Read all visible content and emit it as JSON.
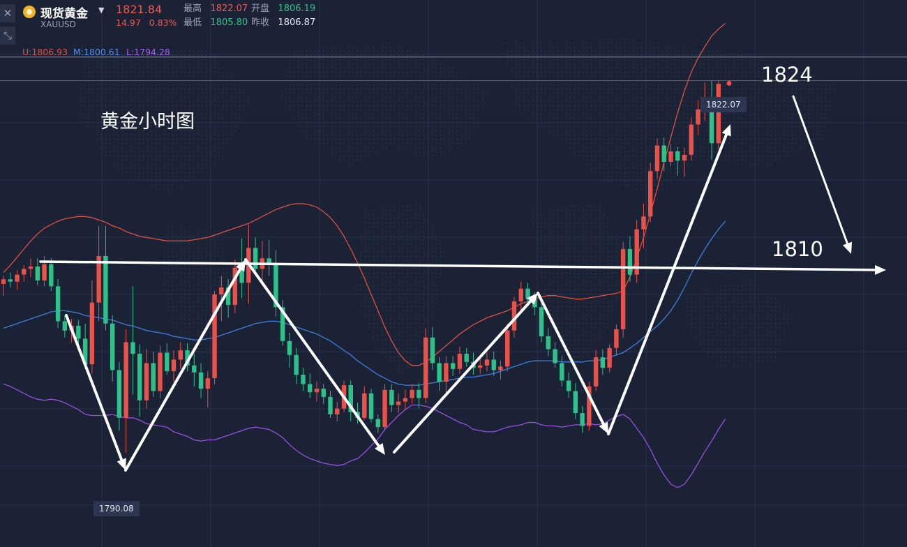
{
  "header": {
    "name": "现货黄金",
    "symbol": "XAUUSD",
    "last_price": "1821.84",
    "change": "14.97",
    "change_pct": "0.83%",
    "high_label": "最高",
    "high_value": "1822.07",
    "open_label": "开盘",
    "open_value": "1806.19",
    "low_label": "最低",
    "low_value": "1805.80",
    "prev_close_label": "昨收",
    "prev_close_value": "1806.87"
  },
  "bollinger": {
    "upper_label": "U:1806.93",
    "mid_label": "M:1800.61",
    "lower_label": "L:1794.28",
    "upper_color": "#e2503f",
    "mid_color": "#3f7fe0",
    "lower_color": "#9b4fe0"
  },
  "annotations": {
    "title_note": "黄金小时图",
    "target_high": "1824",
    "target_support": "1810",
    "high_tag": "1822.07",
    "low_tag": "1790.08"
  },
  "colors": {
    "background": "#1b2235",
    "up": "#e9524a",
    "down": "#2ec28b",
    "grid": "#2a3350"
  },
  "chart_data": {
    "type": "candlestick",
    "title": "黄金小时图",
    "ylim": [
      1782,
      1829
    ],
    "grid": true,
    "series": [
      {
        "name": "candles",
        "values": [
          [
            1804.6,
            1805.3,
            1803.6,
            1805.0
          ],
          [
            1805.0,
            1805.6,
            1804.3,
            1804.8
          ],
          [
            1804.8,
            1805.8,
            1804.1,
            1805.4
          ],
          [
            1805.4,
            1806.2,
            1804.8,
            1805.9
          ],
          [
            1805.9,
            1806.8,
            1805.2,
            1806.1
          ],
          [
            1806.1,
            1806.8,
            1804.5,
            1804.9
          ],
          [
            1804.9,
            1807.0,
            1804.4,
            1806.3
          ],
          [
            1806.3,
            1806.8,
            1804.0,
            1804.4
          ],
          [
            1804.4,
            1805.0,
            1800.8,
            1801.4
          ],
          [
            1801.4,
            1801.9,
            1800.0,
            1800.6
          ],
          [
            1800.6,
            1801.6,
            1799.6,
            1801.0
          ],
          [
            1801.0,
            1801.5,
            1799.2,
            1799.9
          ],
          [
            1799.9,
            1801.2,
            1797.3,
            1797.7
          ],
          [
            1797.7,
            1804.9,
            1796.9,
            1803.0
          ],
          [
            1803.0,
            1809.6,
            1801.4,
            1807.0
          ],
          [
            1807.0,
            1809.6,
            1800.6,
            1801.2
          ],
          [
            1801.2,
            1801.9,
            1796.2,
            1797.2
          ],
          [
            1797.2,
            1797.9,
            1792.0,
            1793.1
          ],
          [
            1793.1,
            1800.7,
            1790.1,
            1799.6
          ],
          [
            1799.6,
            1804.4,
            1795.1,
            1798.6
          ],
          [
            1798.6,
            1799.4,
            1793.2,
            1794.6
          ],
          [
            1794.6,
            1799.0,
            1793.9,
            1797.8
          ],
          [
            1797.8,
            1798.8,
            1794.9,
            1795.4
          ],
          [
            1795.4,
            1799.3,
            1794.8,
            1798.7
          ],
          [
            1798.7,
            1799.5,
            1796.8,
            1797.1
          ],
          [
            1797.1,
            1798.9,
            1796.2,
            1798.1
          ],
          [
            1798.1,
            1799.6,
            1797.3,
            1798.9
          ],
          [
            1798.9,
            1799.5,
            1797.1,
            1797.6
          ],
          [
            1797.6,
            1798.6,
            1795.8,
            1797.0
          ],
          [
            1797.0,
            1797.8,
            1794.8,
            1795.6
          ],
          [
            1795.6,
            1797.1,
            1794.0,
            1796.5
          ],
          [
            1796.5,
            1804.0,
            1796.0,
            1803.7
          ],
          [
            1803.7,
            1805.3,
            1801.4,
            1804.3
          ],
          [
            1804.3,
            1805.0,
            1801.7,
            1802.8
          ],
          [
            1802.8,
            1806.7,
            1802.1,
            1806.0
          ],
          [
            1806.0,
            1808.5,
            1803.4,
            1804.7
          ],
          [
            1804.7,
            1809.7,
            1802.9,
            1807.7
          ],
          [
            1807.7,
            1808.6,
            1805.4,
            1805.9
          ],
          [
            1805.9,
            1808.3,
            1804.6,
            1806.8
          ],
          [
            1806.8,
            1808.4,
            1805.3,
            1806.4
          ],
          [
            1806.4,
            1807.5,
            1801.8,
            1802.6
          ],
          [
            1802.6,
            1803.2,
            1799.3,
            1799.7
          ],
          [
            1799.7,
            1800.4,
            1797.4,
            1798.5
          ],
          [
            1798.5,
            1799.1,
            1796.0,
            1796.8
          ],
          [
            1796.8,
            1797.4,
            1795.4,
            1796.0
          ],
          [
            1796.0,
            1796.9,
            1794.8,
            1795.3
          ],
          [
            1795.3,
            1796.2,
            1794.5,
            1795.6
          ],
          [
            1795.6,
            1796.0,
            1794.3,
            1794.9
          ],
          [
            1794.9,
            1795.4,
            1793.1,
            1793.4
          ],
          [
            1793.4,
            1794.5,
            1792.8,
            1793.9
          ],
          [
            1793.9,
            1796.3,
            1793.6,
            1795.9
          ],
          [
            1795.9,
            1796.3,
            1792.8,
            1793.6
          ],
          [
            1793.6,
            1794.4,
            1792.6,
            1793.1
          ],
          [
            1793.1,
            1795.8,
            1792.9,
            1795.2
          ],
          [
            1795.2,
            1795.6,
            1792.7,
            1793.0
          ],
          [
            1793.0,
            1793.4,
            1791.8,
            1792.3
          ],
          [
            1792.3,
            1796.0,
            1792.0,
            1795.5
          ],
          [
            1795.5,
            1796.0,
            1793.6,
            1794.2
          ],
          [
            1794.2,
            1795.2,
            1793.5,
            1794.5
          ],
          [
            1794.5,
            1795.5,
            1793.8,
            1794.8
          ],
          [
            1794.8,
            1796.0,
            1794.3,
            1795.5
          ],
          [
            1795.5,
            1796.1,
            1793.9,
            1794.8
          ],
          [
            1794.8,
            1800.8,
            1794.4,
            1800.0
          ],
          [
            1800.0,
            1800.9,
            1797.2,
            1797.8
          ],
          [
            1797.8,
            1798.3,
            1795.4,
            1796.2
          ],
          [
            1796.2,
            1798.4,
            1795.2,
            1797.8
          ],
          [
            1797.8,
            1798.4,
            1796.7,
            1797.3
          ],
          [
            1797.3,
            1799.2,
            1796.9,
            1798.6
          ],
          [
            1798.6,
            1799.1,
            1797.5,
            1797.9
          ],
          [
            1797.9,
            1798.7,
            1796.8,
            1797.4
          ],
          [
            1797.4,
            1798.3,
            1796.9,
            1797.6
          ],
          [
            1797.6,
            1798.7,
            1797.1,
            1798.1
          ],
          [
            1798.1,
            1798.8,
            1796.7,
            1797.2
          ],
          [
            1797.2,
            1798.0,
            1796.4,
            1797.5
          ],
          [
            1797.5,
            1801.2,
            1797.1,
            1800.6
          ],
          [
            1800.6,
            1803.5,
            1800.0,
            1803.1
          ],
          [
            1803.1,
            1804.8,
            1802.3,
            1804.2
          ],
          [
            1804.2,
            1804.7,
            1802.8,
            1803.3
          ],
          [
            1803.3,
            1803.9,
            1801.9,
            1802.6
          ],
          [
            1802.6,
            1803.2,
            1799.6,
            1800.1
          ],
          [
            1800.1,
            1800.8,
            1798.4,
            1799.0
          ],
          [
            1799.0,
            1799.6,
            1797.4,
            1797.8
          ],
          [
            1797.8,
            1798.4,
            1795.8,
            1796.3
          ],
          [
            1796.3,
            1797.0,
            1794.8,
            1795.4
          ],
          [
            1795.4,
            1796.1,
            1793.0,
            1793.5
          ],
          [
            1793.5,
            1794.1,
            1791.8,
            1792.4
          ],
          [
            1792.4,
            1796.2,
            1792.0,
            1795.8
          ],
          [
            1795.8,
            1798.9,
            1795.4,
            1798.3
          ],
          [
            1798.3,
            1799.0,
            1796.8,
            1797.4
          ],
          [
            1797.4,
            1799.4,
            1797.0,
            1799.1
          ],
          [
            1799.1,
            1801.1,
            1798.5,
            1800.7
          ],
          [
            1800.7,
            1808.2,
            1800.0,
            1807.6
          ],
          [
            1807.6,
            1808.7,
            1804.8,
            1805.4
          ],
          [
            1805.4,
            1810.1,
            1804.7,
            1809.3
          ],
          [
            1809.3,
            1811.5,
            1807.7,
            1810.4
          ],
          [
            1810.4,
            1815.0,
            1809.9,
            1814.3
          ],
          [
            1814.3,
            1817.1,
            1813.6,
            1816.5
          ],
          [
            1816.5,
            1817.2,
            1814.3,
            1815.1
          ],
          [
            1815.1,
            1816.6,
            1814.7,
            1816.0
          ],
          [
            1816.0,
            1816.4,
            1813.9,
            1815.2
          ],
          [
            1815.2,
            1816.3,
            1813.8,
            1815.7
          ],
          [
            1815.7,
            1818.9,
            1815.2,
            1818.3
          ],
          [
            1818.3,
            1820.4,
            1817.4,
            1819.6
          ],
          [
            1819.6,
            1821.9,
            1818.6,
            1820.3
          ],
          [
            1820.3,
            1822.1,
            1815.3,
            1816.7
          ],
          [
            1816.7,
            1822.1,
            1816.2,
            1821.8
          ]
        ]
      },
      {
        "name": "U",
        "values": [
          1805.6,
          1806.2,
          1806.9,
          1807.6,
          1808.3,
          1808.9,
          1809.4,
          1809.7,
          1810.0,
          1810.2,
          1810.3,
          1810.4,
          1810.4,
          1810.3,
          1810.1,
          1809.9,
          1809.6,
          1809.4,
          1809.1,
          1808.9,
          1808.7,
          1808.6,
          1808.5,
          1808.4,
          1808.3,
          1808.3,
          1808.3,
          1808.3,
          1808.4,
          1808.5,
          1808.6,
          1808.8,
          1809.0,
          1809.2,
          1809.4,
          1809.6,
          1809.8,
          1810.1,
          1810.4,
          1810.7,
          1811.0,
          1811.2,
          1811.4,
          1811.5,
          1811.5,
          1811.4,
          1811.2,
          1810.8,
          1810.3,
          1809.6,
          1808.7,
          1807.6,
          1806.4,
          1805.1,
          1803.7,
          1802.3,
          1800.9,
          1799.7,
          1798.7,
          1798.0,
          1797.6,
          1797.6,
          1797.9,
          1798.3,
          1798.8,
          1799.3,
          1799.8,
          1800.3,
          1800.7,
          1801.1,
          1801.4,
          1801.7,
          1801.9,
          1802.1,
          1802.3,
          1802.6,
          1802.9,
          1803.1,
          1803.3,
          1803.5,
          1803.6,
          1803.6,
          1803.5,
          1803.4,
          1803.3,
          1803.3,
          1803.4,
          1803.5,
          1803.6,
          1803.7,
          1803.8,
          1804.0,
          1805.2,
          1806.8,
          1808.6,
          1810.6,
          1812.8,
          1815.0,
          1817.2,
          1819.3,
          1821.2,
          1822.8,
          1824.0,
          1825.0,
          1825.9,
          1826.5,
          1827.0
        ]
      },
      {
        "name": "M",
        "values": [
          1800.8,
          1801.0,
          1801.2,
          1801.4,
          1801.6,
          1801.8,
          1802.0,
          1802.2,
          1802.3,
          1802.3,
          1802.2,
          1802.1,
          1801.9,
          1801.8,
          1801.7,
          1801.6,
          1801.5,
          1801.3,
          1801.1,
          1801.0,
          1800.8,
          1800.6,
          1800.5,
          1800.4,
          1800.3,
          1800.1,
          1800.0,
          1799.9,
          1799.8,
          1799.8,
          1799.9,
          1800.0,
          1800.2,
          1800.4,
          1800.6,
          1800.8,
          1801.0,
          1801.2,
          1801.3,
          1801.4,
          1801.4,
          1801.3,
          1801.1,
          1800.9,
          1800.7,
          1800.5,
          1800.3,
          1800.0,
          1799.7,
          1799.3,
          1798.9,
          1798.5,
          1798.0,
          1797.6,
          1797.2,
          1796.8,
          1796.5,
          1796.2,
          1796.0,
          1795.9,
          1795.9,
          1795.9,
          1796.0,
          1796.1,
          1796.2,
          1796.3,
          1796.4,
          1796.5,
          1796.6,
          1796.6,
          1796.7,
          1796.8,
          1796.9,
          1797.1,
          1797.3,
          1797.5,
          1797.7,
          1797.9,
          1798.0,
          1798.0,
          1798.0,
          1798.0,
          1797.9,
          1797.9,
          1797.9,
          1797.9,
          1798.0,
          1798.0,
          1798.1,
          1798.3,
          1798.5,
          1798.7,
          1799.1,
          1799.5,
          1800.0,
          1800.5,
          1801.0,
          1801.6,
          1802.3,
          1803.2,
          1804.3,
          1805.5,
          1806.6,
          1807.6,
          1808.5,
          1809.3,
          1810.0
        ]
      },
      {
        "name": "L",
        "values": [
          1796.0,
          1795.8,
          1795.5,
          1795.2,
          1794.9,
          1794.7,
          1794.6,
          1794.7,
          1794.6,
          1794.4,
          1794.1,
          1793.8,
          1793.4,
          1793.3,
          1793.3,
          1793.3,
          1793.4,
          1793.2,
          1793.1,
          1793.1,
          1792.9,
          1792.6,
          1792.5,
          1792.4,
          1792.3,
          1791.9,
          1791.7,
          1791.5,
          1791.2,
          1791.1,
          1791.2,
          1791.2,
          1791.4,
          1791.6,
          1791.8,
          1792.0,
          1792.2,
          1792.3,
          1792.2,
          1792.1,
          1791.8,
          1791.4,
          1790.8,
          1790.3,
          1789.9,
          1789.6,
          1789.4,
          1789.2,
          1789.1,
          1789.0,
          1789.1,
          1789.4,
          1789.6,
          1790.1,
          1790.7,
          1791.3,
          1792.1,
          1792.7,
          1793.3,
          1793.8,
          1794.2,
          1794.2,
          1794.1,
          1793.9,
          1793.6,
          1793.3,
          1793.0,
          1792.7,
          1792.5,
          1792.1,
          1792.0,
          1791.9,
          1791.9,
          1792.1,
          1792.3,
          1792.4,
          1792.5,
          1792.7,
          1792.7,
          1792.5,
          1792.4,
          1792.4,
          1792.3,
          1792.4,
          1792.5,
          1792.5,
          1792.6,
          1792.5,
          1792.6,
          1792.9,
          1793.2,
          1793.4,
          1793.0,
          1792.2,
          1791.4,
          1790.4,
          1789.2,
          1788.2,
          1787.4,
          1787.1,
          1787.4,
          1788.2,
          1789.2,
          1790.2,
          1791.1,
          1792.1,
          1793.0
        ]
      }
    ]
  }
}
